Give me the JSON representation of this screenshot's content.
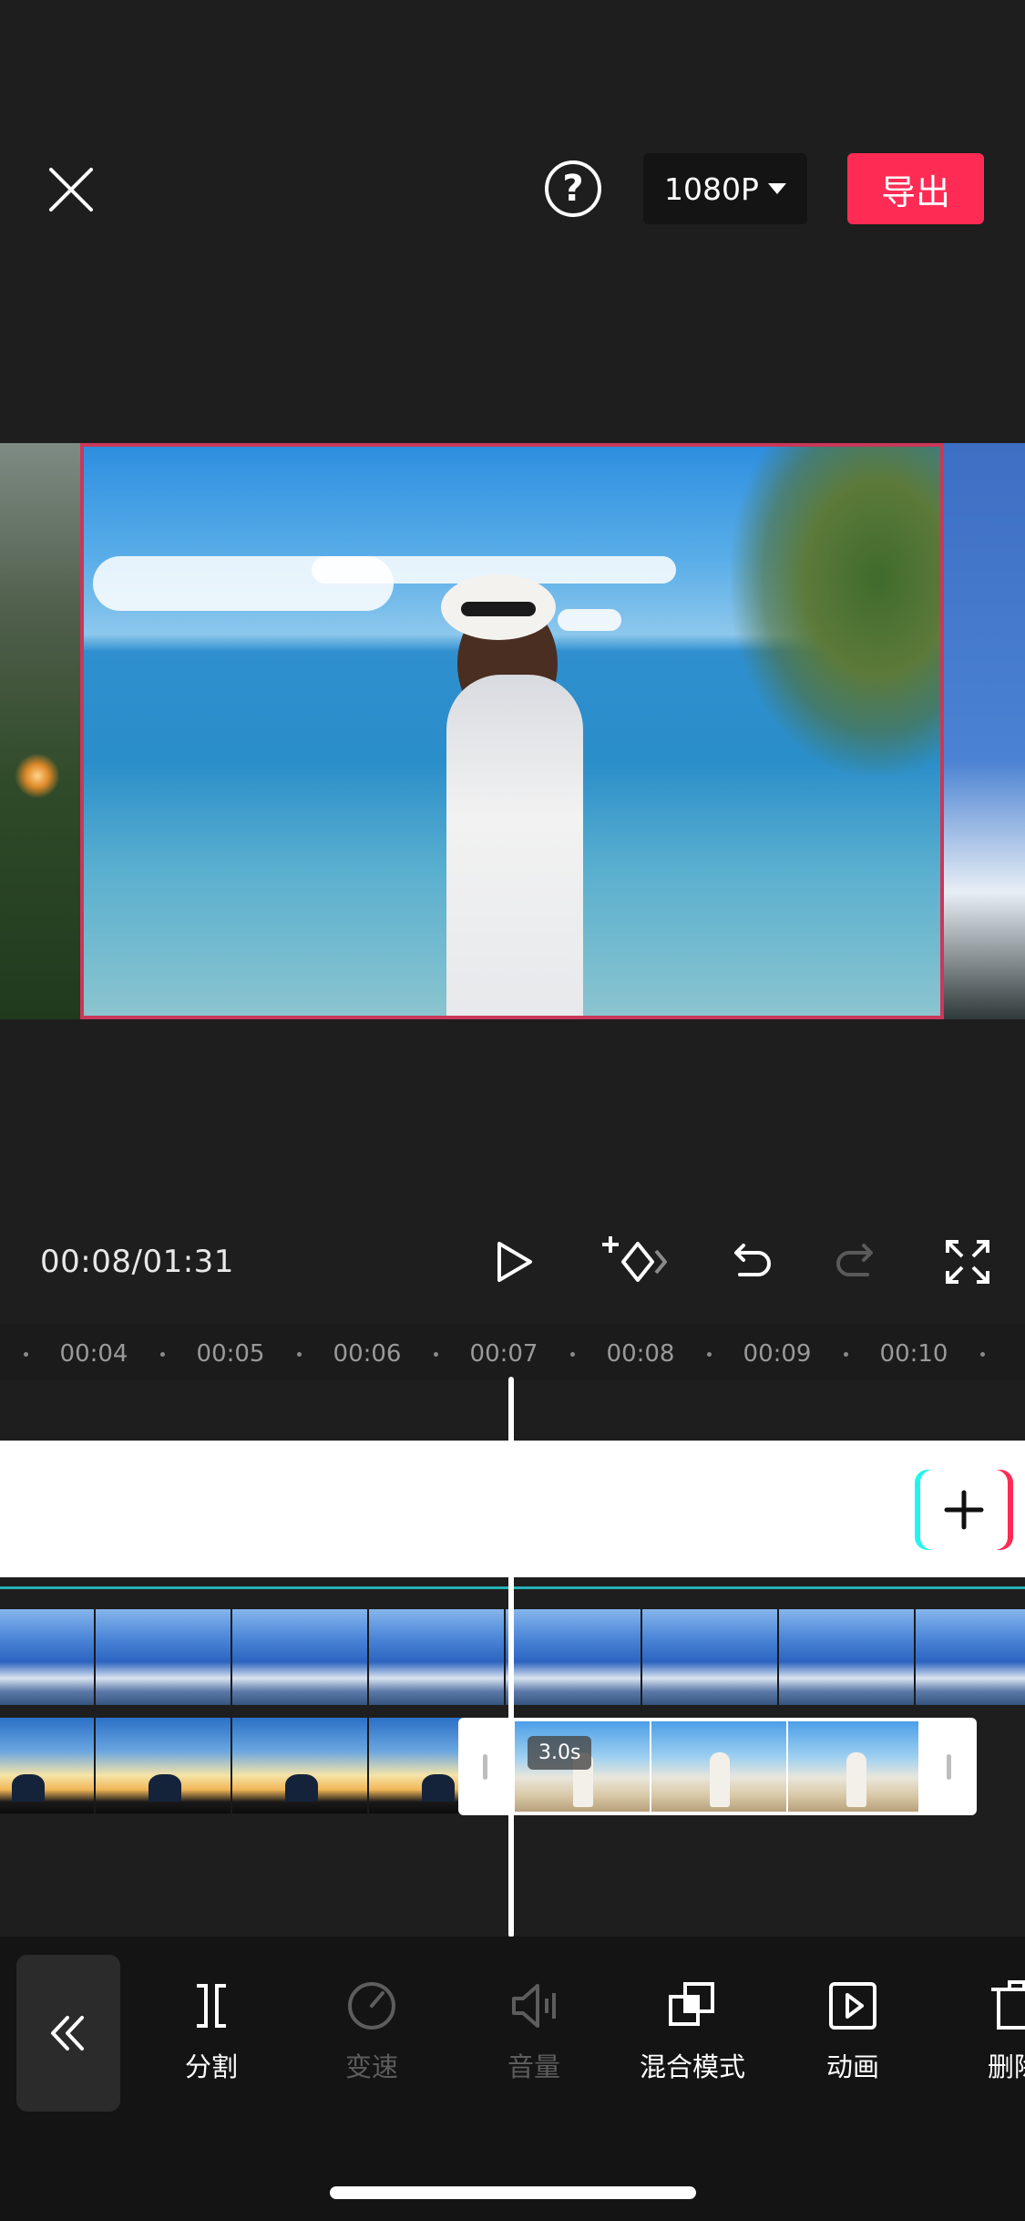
{
  "header": {
    "resolution_label": "1080P",
    "export_label": "导出",
    "help_label": "?"
  },
  "player": {
    "current_time": "00:08",
    "total_time": "01:31",
    "time_display": "00:08/01:31"
  },
  "ruler": {
    "ticks": [
      "00:04",
      "00:05",
      "00:06",
      "00:07",
      "00:08",
      "00:09",
      "00:10"
    ]
  },
  "timeline": {
    "selected_clip_duration": "3.0s"
  },
  "toolbar": {
    "items": [
      {
        "label": "分割",
        "icon": "split-icon",
        "enabled": true
      },
      {
        "label": "变速",
        "icon": "speed-icon",
        "enabled": false
      },
      {
        "label": "音量",
        "icon": "volume-icon",
        "enabled": false
      },
      {
        "label": "混合模式",
        "icon": "blend-mode-icon",
        "enabled": true
      },
      {
        "label": "动画",
        "icon": "animation-icon",
        "enabled": true
      },
      {
        "label": "删除",
        "icon": "delete-icon",
        "enabled": true
      }
    ]
  },
  "colors": {
    "accent": "#fe2c55",
    "background": "#1e1e1e",
    "toolbar_background": "#141414",
    "selection_border": "#c9385a",
    "track_highlight": "#27b3b8"
  }
}
